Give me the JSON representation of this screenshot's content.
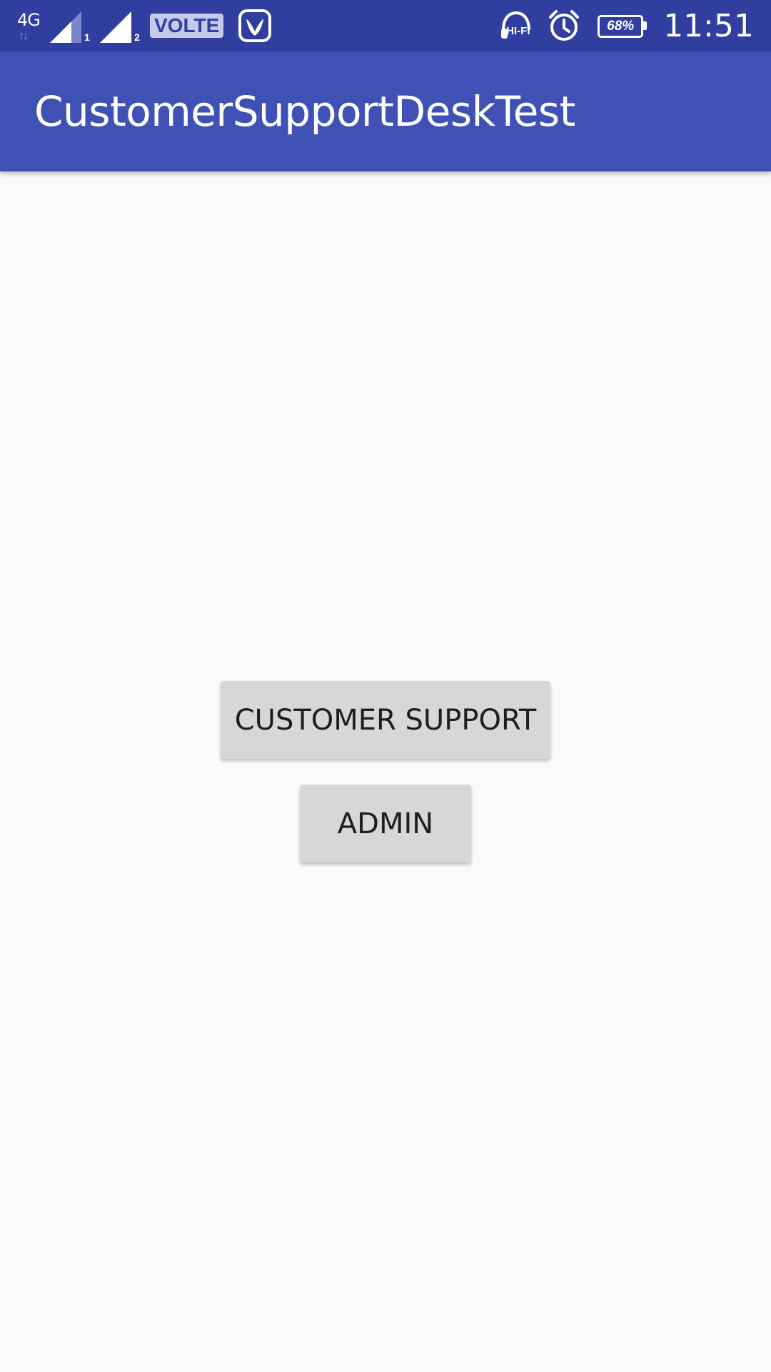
{
  "status_bar": {
    "network_type": "4G",
    "sim1_label": "1",
    "sim2_label": "2",
    "volte_label": "VOLTE",
    "hifi_label": "HI-FI",
    "battery_percent": "68%",
    "time": "11:51",
    "icons": [
      "network-4g-icon",
      "signal-sim1-icon",
      "signal-sim2-icon",
      "volte-icon",
      "saavn-app-icon",
      "hifi-headphones-icon",
      "alarm-icon",
      "battery-icon"
    ],
    "background_color": "#303f9f"
  },
  "app_bar": {
    "title": "CustomerSupportDeskTest",
    "background_color": "#3f51b5"
  },
  "main": {
    "customer_support_button": "CUSTOMER SUPPORT",
    "admin_button": "ADMIN",
    "button_color": "#d6d7d7",
    "background_color": "#fafafa"
  }
}
